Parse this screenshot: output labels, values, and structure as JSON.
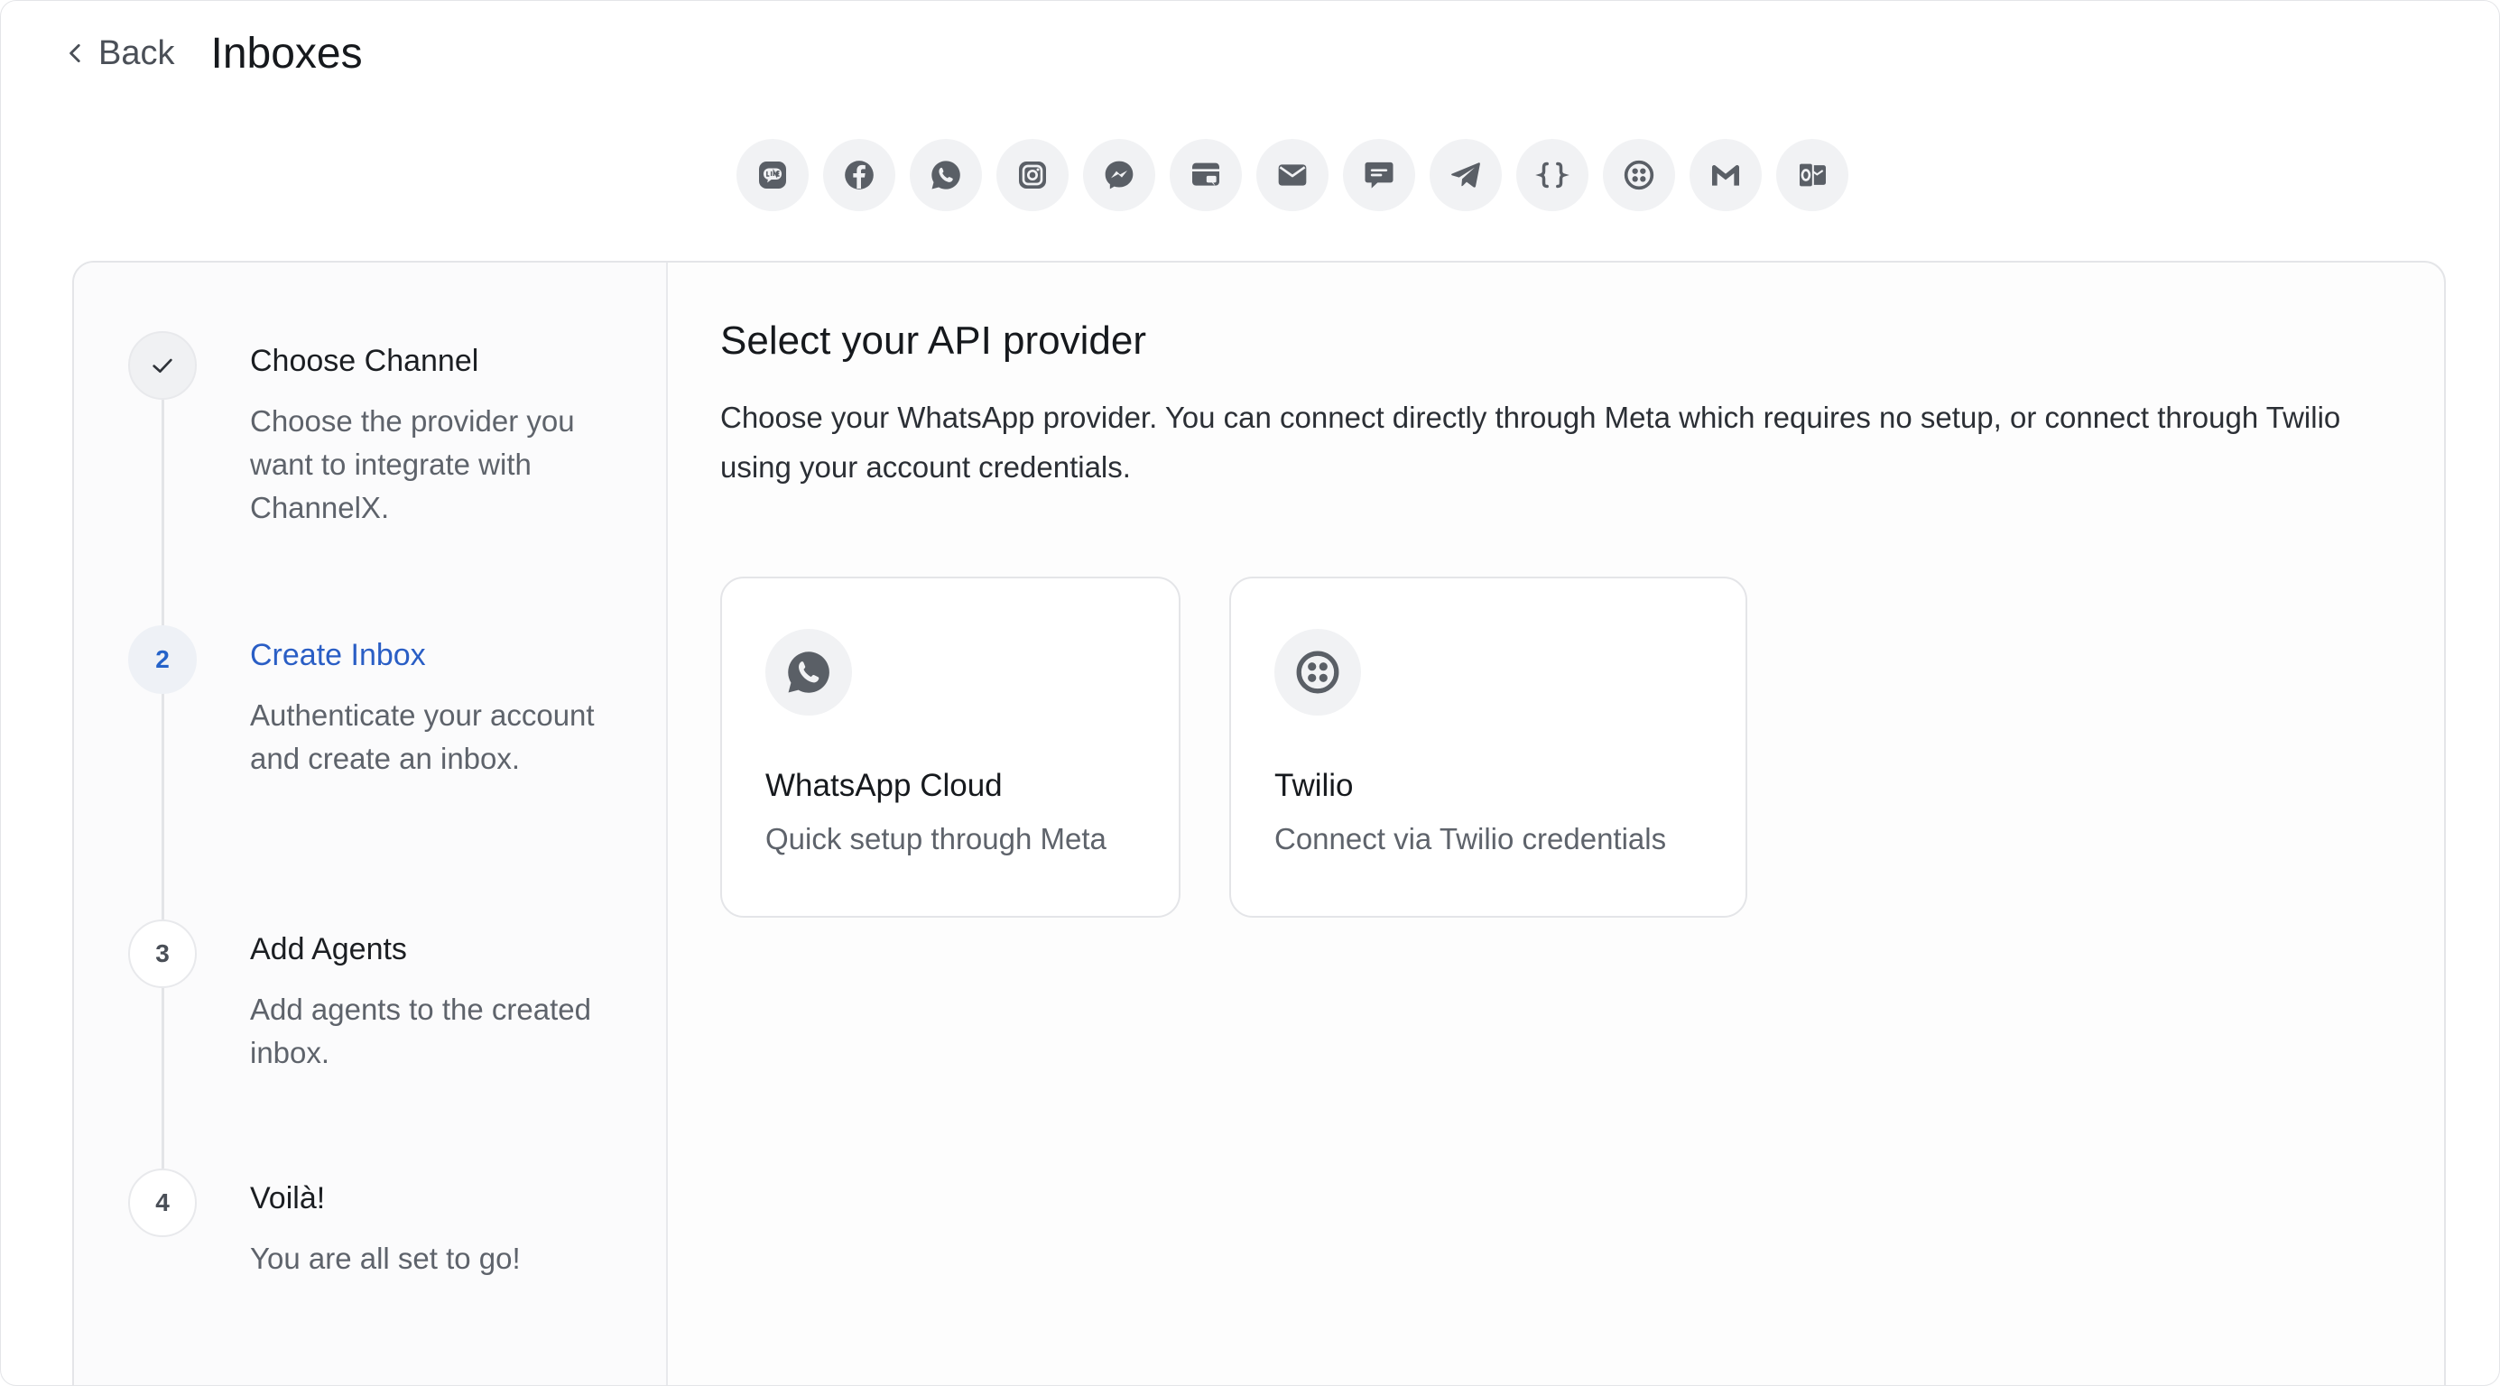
{
  "header": {
    "back_label": "Back",
    "title": "Inboxes"
  },
  "channels": [
    {
      "icon": "line-icon"
    },
    {
      "icon": "facebook-icon"
    },
    {
      "icon": "whatsapp-icon"
    },
    {
      "icon": "instagram-icon"
    },
    {
      "icon": "messenger-icon"
    },
    {
      "icon": "website-widget-icon"
    },
    {
      "icon": "email-icon"
    },
    {
      "icon": "sms-icon"
    },
    {
      "icon": "telegram-icon"
    },
    {
      "icon": "api-braces-icon"
    },
    {
      "icon": "twilio-icon"
    },
    {
      "icon": "gmail-icon"
    },
    {
      "icon": "outlook-icon"
    }
  ],
  "steps": [
    {
      "marker": "✓",
      "title": "Choose Channel",
      "description": "Choose the provider you want to integrate with ChannelX.",
      "state": "done"
    },
    {
      "marker": "2",
      "title": "Create Inbox",
      "description": "Authenticate your account and create an inbox.",
      "state": "active"
    },
    {
      "marker": "3",
      "title": "Add Agents",
      "description": "Add agents to the created inbox.",
      "state": "pending"
    },
    {
      "marker": "4",
      "title": "Voilà!",
      "description": "You are all set to go!",
      "state": "pending"
    }
  ],
  "content": {
    "title": "Select your API provider",
    "description": "Choose your WhatsApp provider. You can connect directly through Meta which requires no setup, or connect through Twilio using your account credentials."
  },
  "providers": [
    {
      "name": "WhatsApp Cloud",
      "subtitle": "Quick setup through Meta",
      "icon": "whatsapp-icon"
    },
    {
      "name": "Twilio",
      "subtitle": "Connect via Twilio credentials",
      "icon": "twilio-icon"
    }
  ],
  "colors": {
    "accent": "#2a5ec5",
    "icon": "#5a5f66",
    "icon_bg": "#f1f2f4"
  }
}
